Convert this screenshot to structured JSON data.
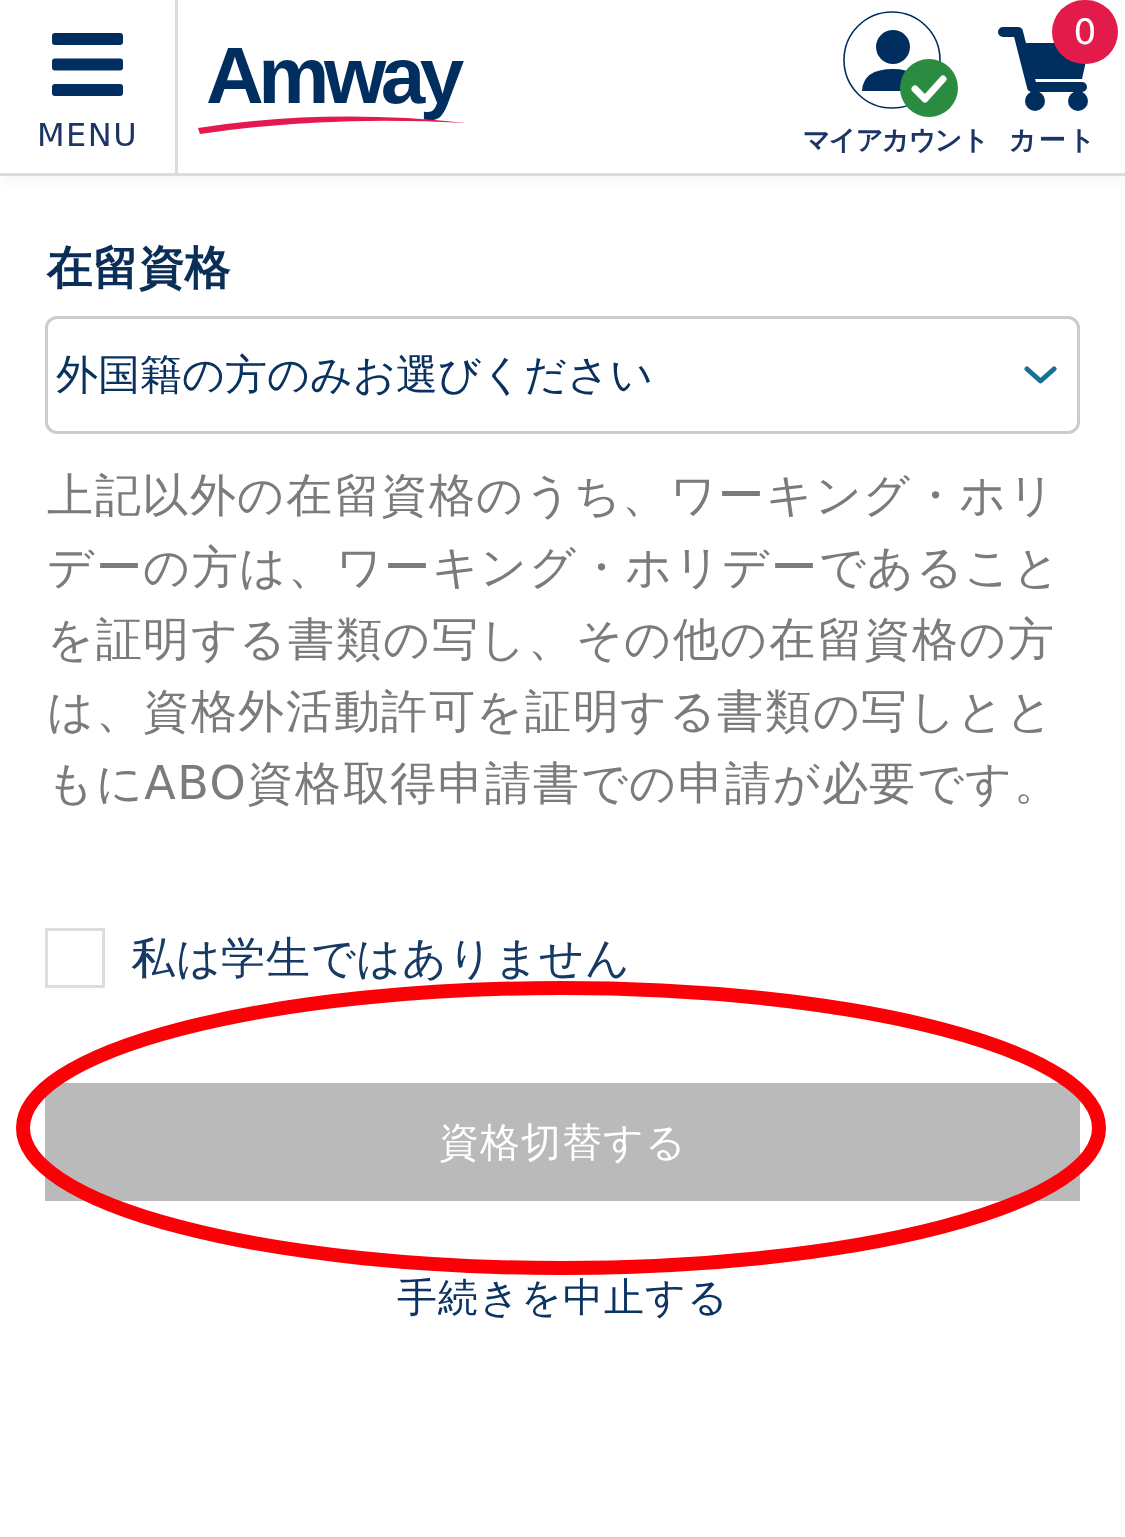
{
  "header": {
    "menu": {
      "label": "MENU"
    },
    "logo": {
      "text": "Amway"
    },
    "account": {
      "label": "マイアカウント",
      "signed_in": true
    },
    "cart": {
      "label": "カート",
      "count": "0"
    }
  },
  "form": {
    "heading": "在留資格",
    "residence_select": {
      "value": "外国籍の方のみお選びください"
    },
    "note": "上記以外の在留資格のうち、ワーキング・ホリデーの方は、ワーキング・ホリデーであることを証明する書類の写し、その他の在留資格の方は、資格外活動許可を証明する書類の写しとともにABO資格取得申請書での申請が必要です。",
    "student_check": {
      "label": "私は学生ではありません",
      "checked": false
    },
    "submit_button": {
      "label": "資格切替する",
      "disabled": true
    },
    "cancel_link": {
      "label": "手続きを中止する"
    }
  },
  "annotations": [
    {
      "kind": "ellipse"
    }
  ]
}
